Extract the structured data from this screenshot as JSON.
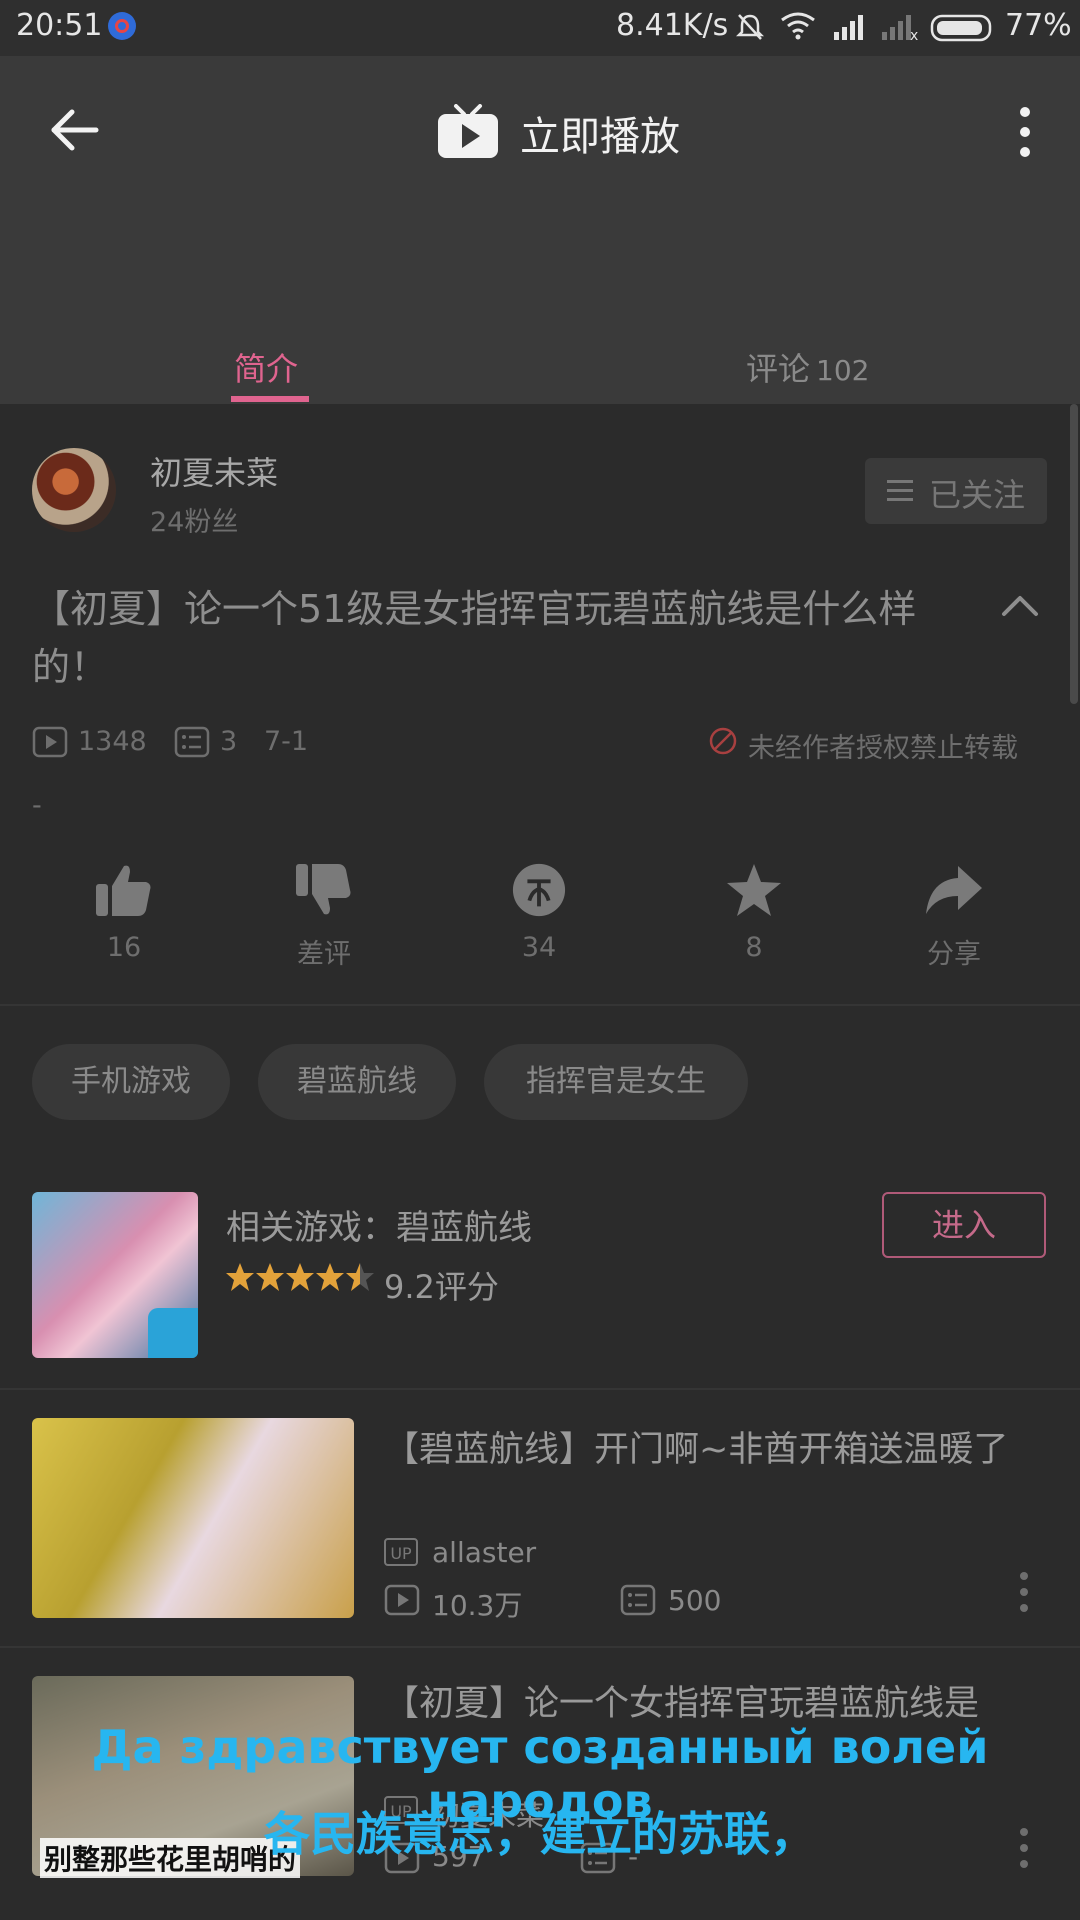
{
  "status_bar": {
    "time": "20:51",
    "net_speed": "8.41K/s",
    "battery": "77%"
  },
  "app_bar": {
    "title": "立即播放"
  },
  "tabs": {
    "intro": "简介",
    "comments_label": "评论",
    "comments_count": "102"
  },
  "author": {
    "name": "初夏未菜",
    "fans": "24粉丝",
    "follow_label": "已关注"
  },
  "video": {
    "title": "【初夏】论一个51级是女指挥官玩碧蓝航线是什么样的！",
    "plays": "1348",
    "danmaku": "3",
    "date": "7-1",
    "copyright_notice": "未经作者授权禁止转载",
    "description": "-"
  },
  "actions": [
    {
      "icon": "thumbs-up-icon",
      "label": "16"
    },
    {
      "icon": "thumbs-down-icon",
      "label": "差评"
    },
    {
      "icon": "coin-icon",
      "label": "34"
    },
    {
      "icon": "star-icon",
      "label": "8"
    },
    {
      "icon": "share-icon",
      "label": "分享"
    }
  ],
  "tags": [
    "手机游戏",
    "碧蓝航线",
    "指挥官是女生"
  ],
  "related_game": {
    "title": "相关游戏：碧蓝航线",
    "score": "9.2评分",
    "rating": 4.5,
    "enter_label": "进入"
  },
  "related_videos": [
    {
      "title": "【碧蓝航线】开门啊~非酋开箱送温暖了",
      "up": "allaster",
      "plays": "10.3万",
      "danmaku": "500"
    },
    {
      "title": "【初夏】论一个女指挥官玩碧蓝航线是",
      "up": "初夏未菜",
      "plays": "597",
      "danmaku": "-",
      "thumb_caption": "别整那些花里胡哨的"
    }
  ],
  "subtitles": {
    "line1": "Да здравствует созданный волей народов",
    "line2": "各民族意志，建立的苏联，"
  },
  "colors": {
    "accent": "#e0648f",
    "background": "#2b2b2b",
    "appbar": "#3a3a3a",
    "subtitle": "#27b6f0"
  }
}
